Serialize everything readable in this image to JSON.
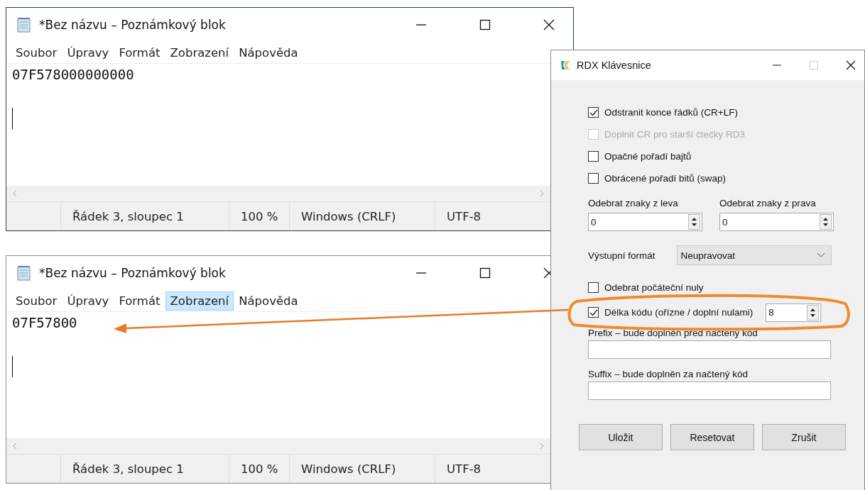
{
  "windows": [
    {
      "title": "*Bez názvu – Poznámkový blok",
      "menu": [
        {
          "label": "Soubor",
          "selected": false
        },
        {
          "label": "Úpravy",
          "selected": false
        },
        {
          "label": "Formát",
          "selected": false
        },
        {
          "label": "Zobrazení",
          "selected": false
        },
        {
          "label": "Nápověda",
          "selected": false
        }
      ],
      "content": "07F578000000000",
      "status_bar": [
        "Řádek 3, sloupec 1",
        "100 %",
        "Windows (CRLF)",
        "UTF-8"
      ]
    },
    {
      "title": "*Bez názvu – Poznámkový blok",
      "menu": [
        {
          "label": "Soubor",
          "selected": false
        },
        {
          "label": "Úpravy",
          "selected": false
        },
        {
          "label": "Formát",
          "selected": false
        },
        {
          "label": "Zobrazení",
          "selected": true
        },
        {
          "label": "Nápověda",
          "selected": false
        }
      ],
      "content": "07F57800",
      "status_bar": [
        "Řádek 3, sloupec 1",
        "100 %",
        "Windows (CRLF)",
        "UTF-8"
      ]
    }
  ],
  "dialog": {
    "title": "RDX Klávesnice",
    "options": [
      {
        "label": "Odstranit konce řádků (CR+LF)",
        "checked": true,
        "disabled": false
      },
      {
        "label": "Doplnit CR pro starší čtečky RD3",
        "checked": false,
        "disabled": true
      },
      {
        "label": "Opačné pořadí bajtů",
        "checked": false,
        "disabled": false
      },
      {
        "label": "Obrácené pořadí bitů (swap)",
        "checked": false,
        "disabled": false
      }
    ],
    "trims": [
      {
        "label": "Odebrat znaky z leva",
        "value": "0"
      },
      {
        "label": "Odebrat znaky z prava",
        "value": "0"
      }
    ],
    "output_format": {
      "label": "Výstupní formát",
      "value": "Neupravovat"
    },
    "strip_zeros": {
      "label": "Odebrat počáteční nuly",
      "checked": false
    },
    "code_length": {
      "label": "Délka kódu (ořízne / doplní nulami)",
      "checked": true,
      "value": "8"
    },
    "text_fields": [
      {
        "label": "Prefix – bude doplněn před načtený kód"
      },
      {
        "label": "Suffix – bude doplněn za načtený kód"
      }
    ],
    "buttons": [
      "Uložit",
      "Resetovat",
      "Zrušit"
    ]
  }
}
